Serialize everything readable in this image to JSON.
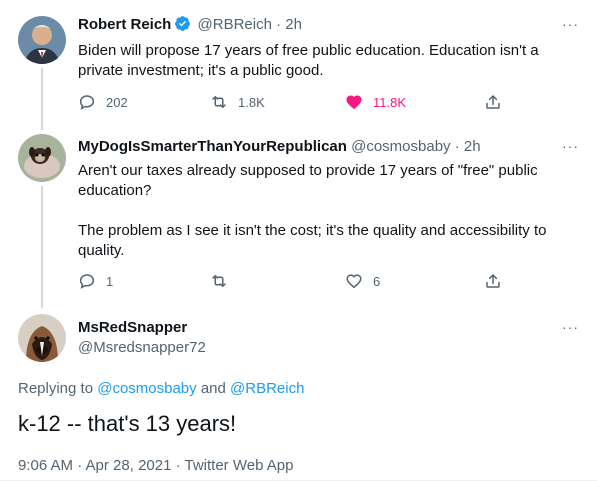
{
  "colors": {
    "accent": "#1d9bf0",
    "like": "#f91880",
    "secondary_text": "#536471",
    "thread_line": "#cfd9de"
  },
  "tweet1": {
    "name": "Robert Reich",
    "verified": true,
    "handle_time": "@RBReich · 2h",
    "text": "Biden will propose 17 years of free public education. Education isn't a private investment; it's a public good.",
    "replies": "202",
    "retweets": "1.8K",
    "likes": "11.8K",
    "liked": true,
    "more": "···"
  },
  "tweet2": {
    "name": "MyDogIsSmarterThanYourRepublican",
    "handle_time": "@cosmosbaby · 2h",
    "text": "Aren't our taxes already supposed to provide 17 years of \"free\" public education?\n\nThe problem as I see it isn't the cost; it's the quality and accessibility to quality.",
    "replies": "1",
    "retweets": "",
    "likes": "6",
    "more": "···"
  },
  "tweet3": {
    "name": "MsRedSnapper",
    "handle": "@Msredsnapper72",
    "replying_prefix": "Replying to ",
    "mention1": "@cosmosbaby",
    "and": " and ",
    "mention2": "@RBReich",
    "text": "k-12 -- that's 13 years!",
    "timestamp": "9:06 AM · Apr 28, 2021 · Twitter Web App",
    "more": "···"
  }
}
